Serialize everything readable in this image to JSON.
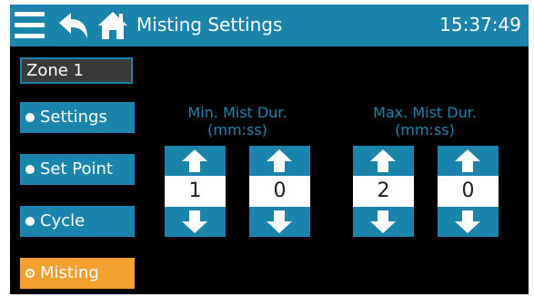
{
  "header": {
    "title": "Misting Settings",
    "time": "15:37:49"
  },
  "zone": "Zone 1",
  "nav": [
    {
      "label": "Settings",
      "selected": false
    },
    {
      "label": "Set Point",
      "selected": false
    },
    {
      "label": "Cycle",
      "selected": false
    },
    {
      "label": "Misting",
      "selected": true
    }
  ],
  "groups": {
    "min": {
      "label_line1": "Min. Mist Dur.",
      "label_line2": "(mm:ss)",
      "minutes": "1",
      "seconds": "0"
    },
    "max": {
      "label_line1": "Max. Mist Dur.",
      "label_line2": "(mm:ss)",
      "minutes": "2",
      "seconds": "0"
    }
  },
  "colors": {
    "accent": "#1b84ad",
    "active": "#f4a030",
    "background": "#000000"
  }
}
